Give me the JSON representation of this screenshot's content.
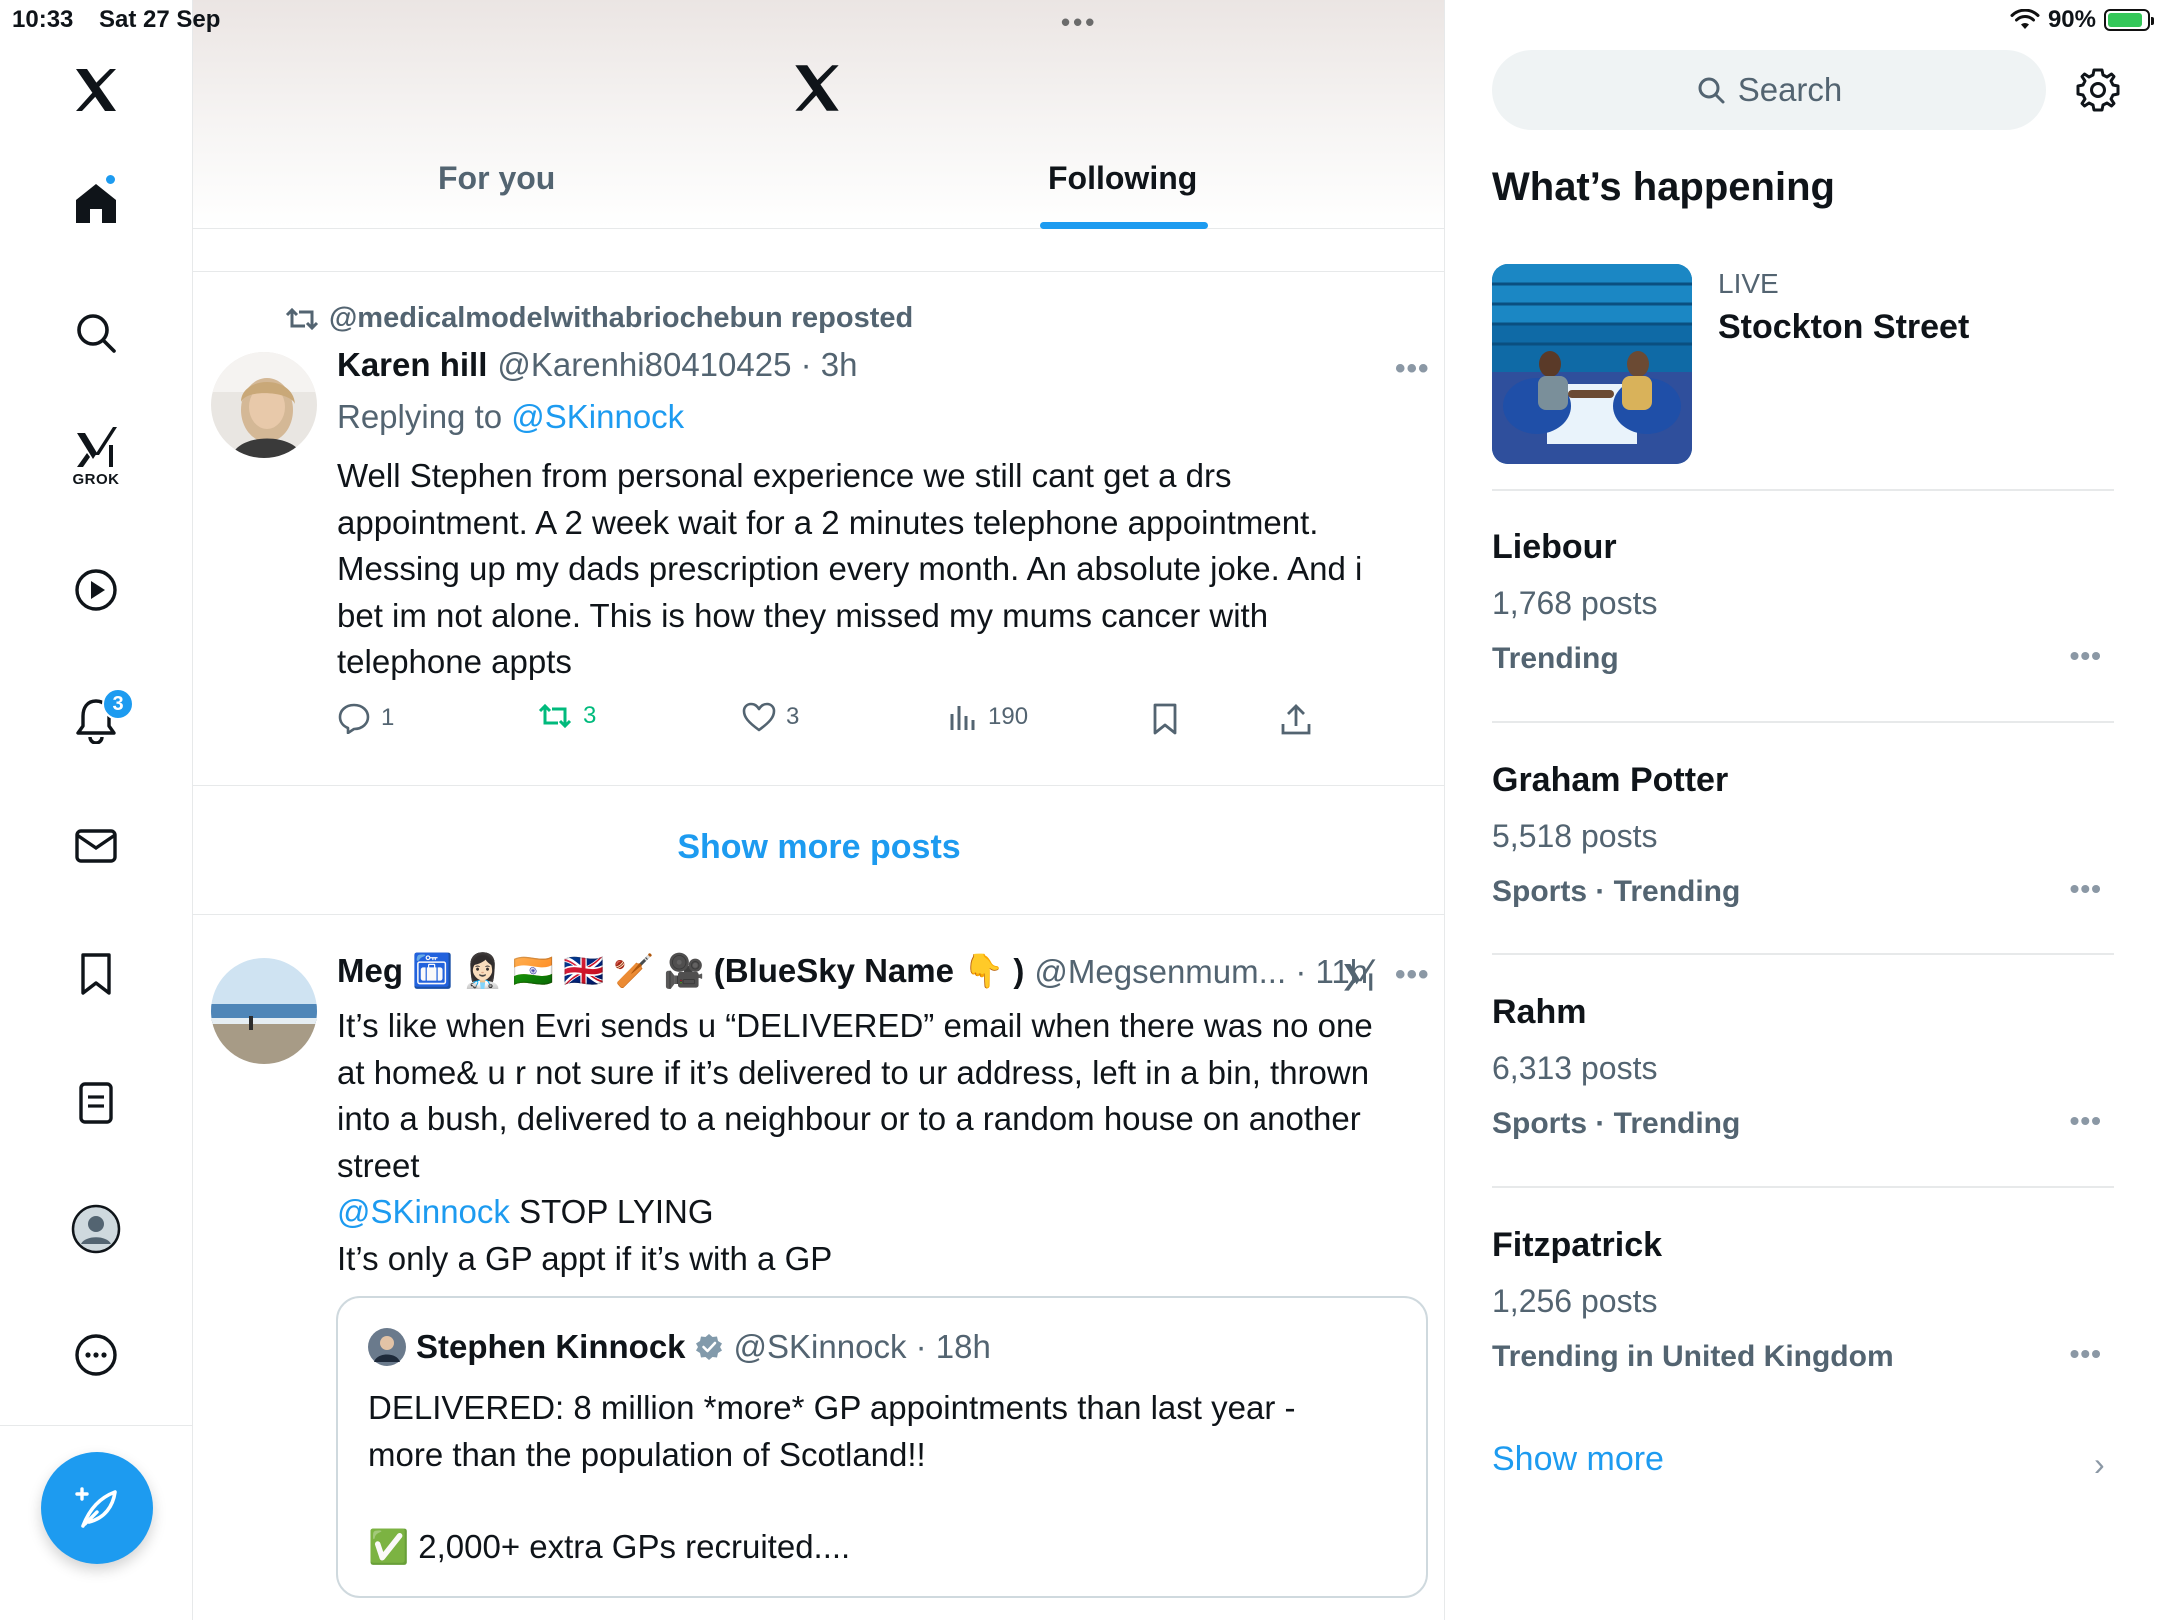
{
  "status_bar": {
    "time": "10:33",
    "date": "Sat 27 Sep",
    "battery": "90%",
    "battery_level": 0.9
  },
  "nav": {
    "notifications_badge": "3",
    "grok_label": "GROK"
  },
  "header": {
    "tabs": [
      {
        "label": "For you"
      },
      {
        "label": "Following"
      }
    ],
    "active_tab": "Following"
  },
  "posts": [
    {
      "repost_text": "@medicalmodelwithabriochebun reposted",
      "name": "Karen hill",
      "handle_time": "@Karenhi80410425 · 3h",
      "reply_prefix": "Replying to ",
      "reply_to": "@SKinnock",
      "lines": [
        "Well Stephen from personal experience we still cant get a drs",
        "appointment.  A 2 week wait for a 2 minutes telephone appointment.",
        "Messing up my dads prescription every month.  An absolute joke.  And i",
        "bet im not alone.  This is how they missed my mums cancer with",
        "telephone appts"
      ],
      "stats": {
        "replies": "1",
        "reposts": "3",
        "likes": "3",
        "views": "190"
      }
    },
    {
      "name": "Meg 🛅 👩🏻‍⚕️ 🇮🇳 🇬🇧 🏏 🎥 (BlueSky Name 👇 )",
      "handle_time": "@Megsenmum... · 11h",
      "lines": [
        "It’s like when Evri sends u “DELIVERED” email when there was no one",
        "at home& u r not sure if it’s delivered to ur address, left in a bin, thrown",
        "into a bush, delivered to a neighbour or to a random house on another",
        "street"
      ],
      "mention": "@SKinnock",
      "mention_suffix": " STOP LYING",
      "last_line": "It’s only a GP appt if it’s with a GP",
      "quote": {
        "name": "Stephen Kinnock",
        "handle_time": "@SKinnock · 18h",
        "lines": [
          "DELIVERED: 8 million *more* GP appointments than last year -",
          "more than the population of Scotland!!"
        ],
        "extra_line": "✅ 2,000+ extra GPs recruited...."
      }
    }
  ],
  "show_more_posts": "Show more posts",
  "sidebar": {
    "search_placeholder": "Search",
    "title": "What’s happening",
    "live": {
      "tag": "LIVE",
      "title": "Stockton Street"
    },
    "trends": [
      {
        "name": "Liebour",
        "count": "1,768 posts",
        "category": "Trending"
      },
      {
        "name": "Graham Potter",
        "count": "5,518 posts",
        "category": "Sports · Trending"
      },
      {
        "name": "Rahm",
        "count": "6,313 posts",
        "category": "Sports · Trending"
      },
      {
        "name": "Fitzpatrick",
        "count": "1,256 posts",
        "category": "Trending in United Kingdom"
      }
    ],
    "show_more": "Show more"
  },
  "colors": {
    "accent": "#1d9bf0",
    "repost_green": "#00ba7c",
    "muted": "#536471",
    "border": "#e7e9ea"
  }
}
